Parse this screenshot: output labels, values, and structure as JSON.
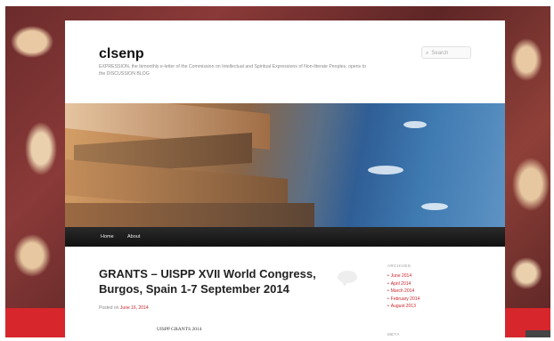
{
  "site": {
    "title": "clsenp",
    "description": "EXPRESSION, the bimonthly e-letter of the Commission on Intellectual and Spiritual Expressions of Non-literate Peoples, opens to the DISCUSSION BLOG"
  },
  "search": {
    "placeholder": "Search",
    "icon": "search-icon"
  },
  "nav": {
    "items": [
      "Home",
      "About"
    ]
  },
  "post": {
    "title": "GRANTS – UISPP XVII World Congress, Burgos, Spain 1-7 September 2014",
    "meta_prefix": "Posted on",
    "date": "June 16, 2014",
    "content_title": "UISPP GRANTS 2014"
  },
  "sidebar": {
    "archives_heading": "ARCHIVES",
    "archives": [
      "June 2014",
      "April 2014",
      "March 2014",
      "February 2014",
      "August 2013"
    ],
    "meta_heading": "META"
  },
  "colors": {
    "accent_red": "#c8262c",
    "nav_bg": "#1a1a1a",
    "page_bg": "#ffffff"
  }
}
